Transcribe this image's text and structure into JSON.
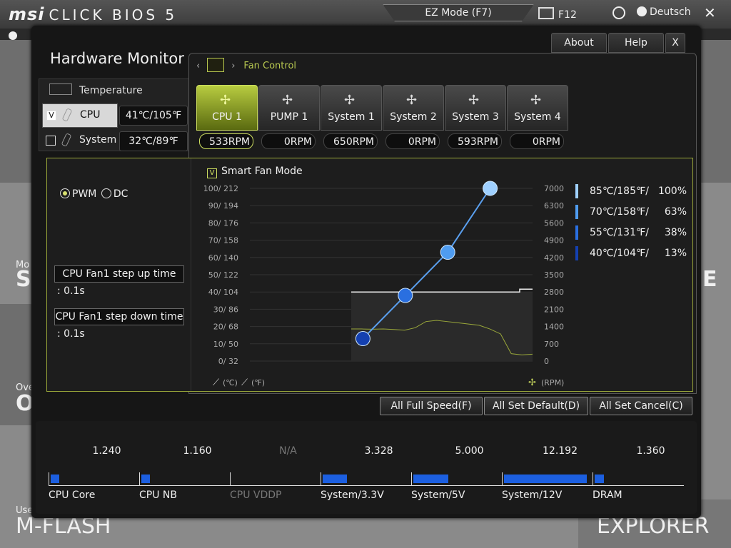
{
  "app": {
    "logo": "msi",
    "logo_sub": "CLICK BIOS 5",
    "ez_mode": "EZ Mode (F7)",
    "f12": "F12",
    "language": "Deutsch"
  },
  "background_tiles": {
    "label_mflash_small": "Use",
    "label_mflash": "M-FLASH",
    "label_explorer": "EXPLORER",
    "label_sm": "S",
    "label_o": "O",
    "label_e": "E",
    "small_mo": "Mo",
    "small_ove": "Ove"
  },
  "modal": {
    "title": "Hardware Monitor",
    "buttons": {
      "about": "About",
      "help": "Help",
      "close": "X"
    }
  },
  "temperature": {
    "header": "Temperature",
    "rows": [
      {
        "name": "CPU",
        "value": "41℃/105℉",
        "checked": true,
        "check": "V"
      },
      {
        "name": "System",
        "value": "32℃/89℉",
        "checked": false,
        "check": ""
      }
    ]
  },
  "fan_control": {
    "tab": "Fan Control",
    "fans": [
      {
        "name": "CPU 1",
        "rpm": "533RPM"
      },
      {
        "name": "PUMP 1",
        "rpm": "0RPM"
      },
      {
        "name": "System 1",
        "rpm": "650RPM"
      },
      {
        "name": "System 2",
        "rpm": "0RPM"
      },
      {
        "name": "System 3",
        "rpm": "593RPM"
      },
      {
        "name": "System 4",
        "rpm": "0RPM"
      }
    ],
    "mode": {
      "pwm": "PWM",
      "dc": "DC",
      "selected": "PWM"
    },
    "step_up_label": "CPU Fan1 step up time",
    "step_up_value": ": 0.1s",
    "step_down_label": "CPU Fan1 step down time",
    "step_down_value": ": 0.1s",
    "smart_fan_mode": "Smart Fan Mode",
    "smart_fan_check": "V",
    "legend": [
      {
        "temp": "85℃/185℉/",
        "pct": "100%",
        "color": "#9fd0ff"
      },
      {
        "temp": "70℃/158℉/",
        "pct": "63%",
        "color": "#4f9cf0"
      },
      {
        "temp": "55℃/131℉/",
        "pct": "38%",
        "color": "#2a6fe0"
      },
      {
        "temp": "40℃/104℉/",
        "pct": "13%",
        "color": "#1440b0"
      }
    ],
    "axis_left_unit": "(℃)",
    "axis_left_unit2": "(℉)",
    "axis_right_unit": "(RPM)",
    "buttons": {
      "full_speed": "All Full Speed(F)",
      "set_default": "All Set Default(D)",
      "set_cancel": "All Set Cancel(C)"
    }
  },
  "chart_data": {
    "type": "line",
    "left_ticks": [
      "100/ 212",
      "90/ 194",
      "80/ 176",
      "70/ 158",
      "60/ 140",
      "50/ 122",
      "40/ 104",
      "30/  86",
      "20/  68",
      "10/  50",
      "0/  32"
    ],
    "right_ticks": [
      "7000",
      "6300",
      "5600",
      "4900",
      "4200",
      "3500",
      "2800",
      "2100",
      "1400",
      "700",
      "0"
    ],
    "series": [
      {
        "name": "fan curve",
        "x_temp_c": [
          40,
          55,
          70,
          85
        ],
        "y_percent": [
          13,
          38,
          63,
          100
        ]
      }
    ],
    "rpm_trace_approx": [
      1300,
      1300,
      1290,
      1300,
      1280,
      1250,
      1350,
      1600,
      1650,
      1600,
      1550,
      1500,
      1450,
      1300,
      1100,
      300,
      250,
      280
    ],
    "threshold_rpm": 2800
  },
  "voltages": [
    {
      "name": "CPU Core",
      "value": "1.240",
      "fill": 0.1,
      "dim": false
    },
    {
      "name": "CPU NB",
      "value": "1.160",
      "fill": 0.1,
      "dim": false
    },
    {
      "name": "CPU VDDP",
      "value": "N/A",
      "fill": 0.0,
      "dim": true
    },
    {
      "name": "System/3.3V",
      "value": "3.328",
      "fill": 0.28,
      "dim": false
    },
    {
      "name": "System/5V",
      "value": "5.000",
      "fill": 0.4,
      "dim": false
    },
    {
      "name": "System/12V",
      "value": "12.192",
      "fill": 0.95,
      "dim": false
    },
    {
      "name": "DRAM",
      "value": "1.360",
      "fill": 0.11,
      "dim": false
    }
  ]
}
